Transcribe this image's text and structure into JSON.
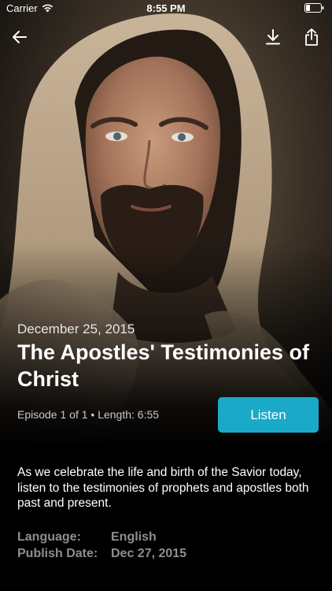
{
  "status_bar": {
    "carrier": "Carrier",
    "time": "8:55 PM",
    "icons": [
      "wifi-icon",
      "battery-icon"
    ]
  },
  "nav": {
    "icons": [
      "arrow-left-icon",
      "download-icon",
      "share-icon"
    ]
  },
  "episode": {
    "date": "December 25, 2015",
    "title": "The Apostles' Testimonies of Christ",
    "info": "Episode 1 of 1 • Length: 6:55",
    "listen_label": "Listen",
    "description": "As we celebrate the life and birth of the Savior today, listen to the testimonies of prophets and apostles both past and present.",
    "details": [
      {
        "label": "Language:",
        "value": "English"
      },
      {
        "label": "Publish Date:",
        "value": "Dec 27, 2015"
      }
    ]
  },
  "colors": {
    "accent": "#1aa9c9",
    "background": "#000000",
    "meta_text": "#8e8e93"
  }
}
